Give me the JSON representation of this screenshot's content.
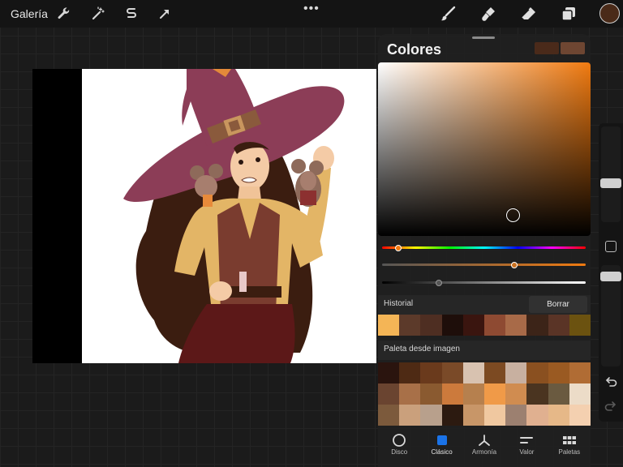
{
  "topbar": {
    "gallery_label": "Galería",
    "left_tools": [
      "wrench-icon",
      "magic-wand-icon",
      "selection-icon",
      "transform-arrow-icon"
    ],
    "more_label": "•••",
    "right_tools": [
      "brush-icon",
      "smudge-icon",
      "eraser-icon",
      "layers-icon"
    ],
    "current_color": "#4a2a18"
  },
  "panel": {
    "title": "Colores",
    "current_swatch": "#4a2a1a",
    "previous_swatch": "#6e4632",
    "hue_color": "#f07a10",
    "history_label": "Historial",
    "clear_label": "Borrar",
    "history_colors": [
      "#f4b556",
      "#5c3a2a",
      "#4e2e22",
      "#1e0e0a",
      "#3a150f",
      "#8e4a32",
      "#a86a48",
      "#3c2418",
      "#5a3426",
      "#6b5210"
    ],
    "palette_label": "Paleta desde imagen",
    "palette_colors": [
      "#2a140e",
      "#4e2a14",
      "#6a3a1c",
      "#7a4a28",
      "#d8c2b0",
      "#7c4a22",
      "#c8b0a0",
      "#8a5020",
      "#9a5a22",
      "#b06c34",
      "#6a4430",
      "#a87048",
      "#8a5a30",
      "#cc7a3c",
      "#b6804e",
      "#f09a48",
      "#d08c50",
      "#4a3420",
      "#6a5a40",
      "#ecdcc8",
      "#7c5a3c",
      "#caa07c",
      "#b8a08c",
      "#2c1a10",
      "#c89668",
      "#f0c8a0",
      "#9c8070",
      "#e0b090",
      "#e6b888",
      "#f4d0b0"
    ],
    "tabs": [
      {
        "label": "Disco",
        "icon": "disc-icon"
      },
      {
        "label": "Clásico",
        "icon": "classic-square-icon"
      },
      {
        "label": "Armonía",
        "icon": "harmony-icon"
      },
      {
        "label": "Valor",
        "icon": "value-sliders-icon"
      },
      {
        "label": "Paletas",
        "icon": "palettes-grid-icon"
      }
    ],
    "active_tab": "Clásico",
    "hue_level": 0.08,
    "saturation_level": 0.65,
    "brightness_level": 0.28
  }
}
